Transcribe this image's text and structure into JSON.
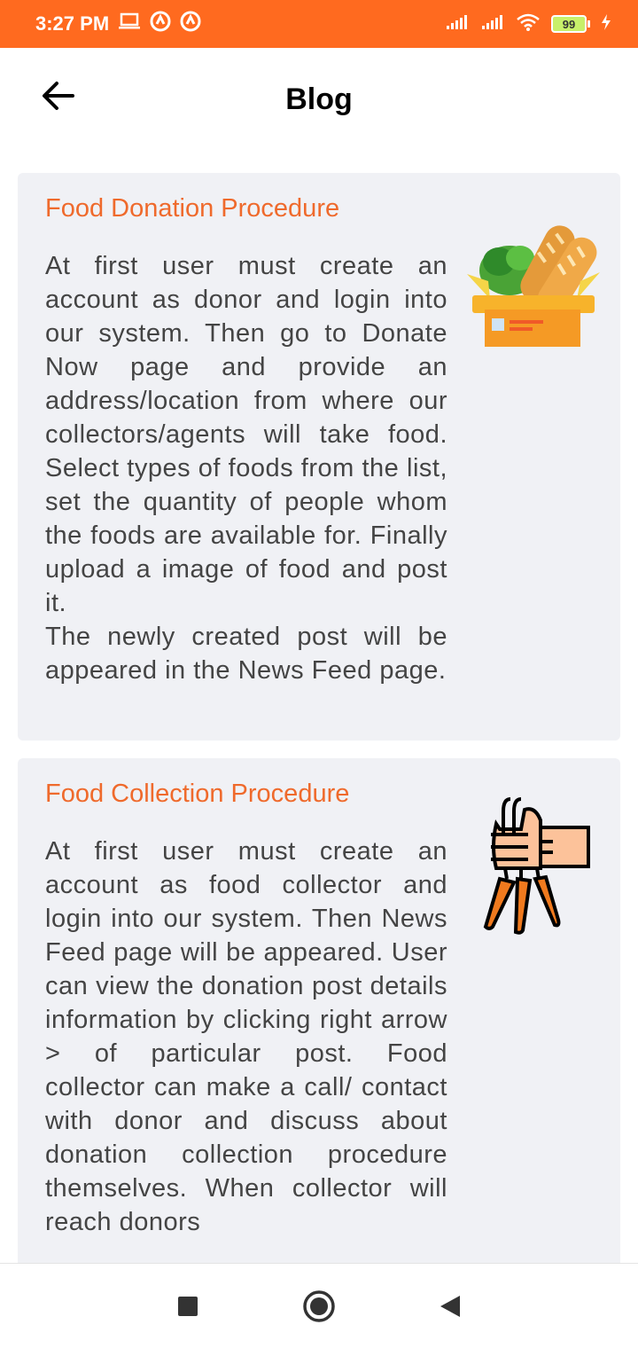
{
  "status_bar": {
    "time": "3:27 PM",
    "battery_level": "99",
    "icons": [
      "laptop-icon",
      "notification-icon",
      "notification-icon",
      "signal-icon",
      "signal-icon",
      "wifi-icon",
      "battery-icon",
      "charging-icon"
    ]
  },
  "app_bar": {
    "title": "Blog",
    "back_icon": "arrow-left-icon"
  },
  "cards": [
    {
      "title": "Food Donation Procedure",
      "body": "At first user must create an account as donor and login into our system. Then go to Donate Now page and provide an address/location from where our collectors/agents will take food. Select types of foods from the list, set the quantity of people whom the foods are available for. Finally upload a image of food and post it.\nThe newly created post will be appeared in the News Feed page.",
      "image": "food-box-illustration"
    },
    {
      "title": "Food Collection Procedure",
      "body": "At first user must create an account as food collector and login into our system. Then News Feed page will be appeared. User can view the donation post details information by clicking right arrow > of particular post. Food collector can make a call/ contact with donor and discuss about donation collection procedure themselves. When collector will reach donors",
      "image": "hand-carrots-illustration"
    }
  ],
  "nav_bar": {
    "icons": [
      "recent-apps-icon",
      "home-icon",
      "back-triangle-icon"
    ]
  },
  "colors": {
    "status_bar": "#ff6a1f",
    "card_title": "#ef6a2c",
    "card_background": "#f0f1f5",
    "body_text": "#444444"
  }
}
